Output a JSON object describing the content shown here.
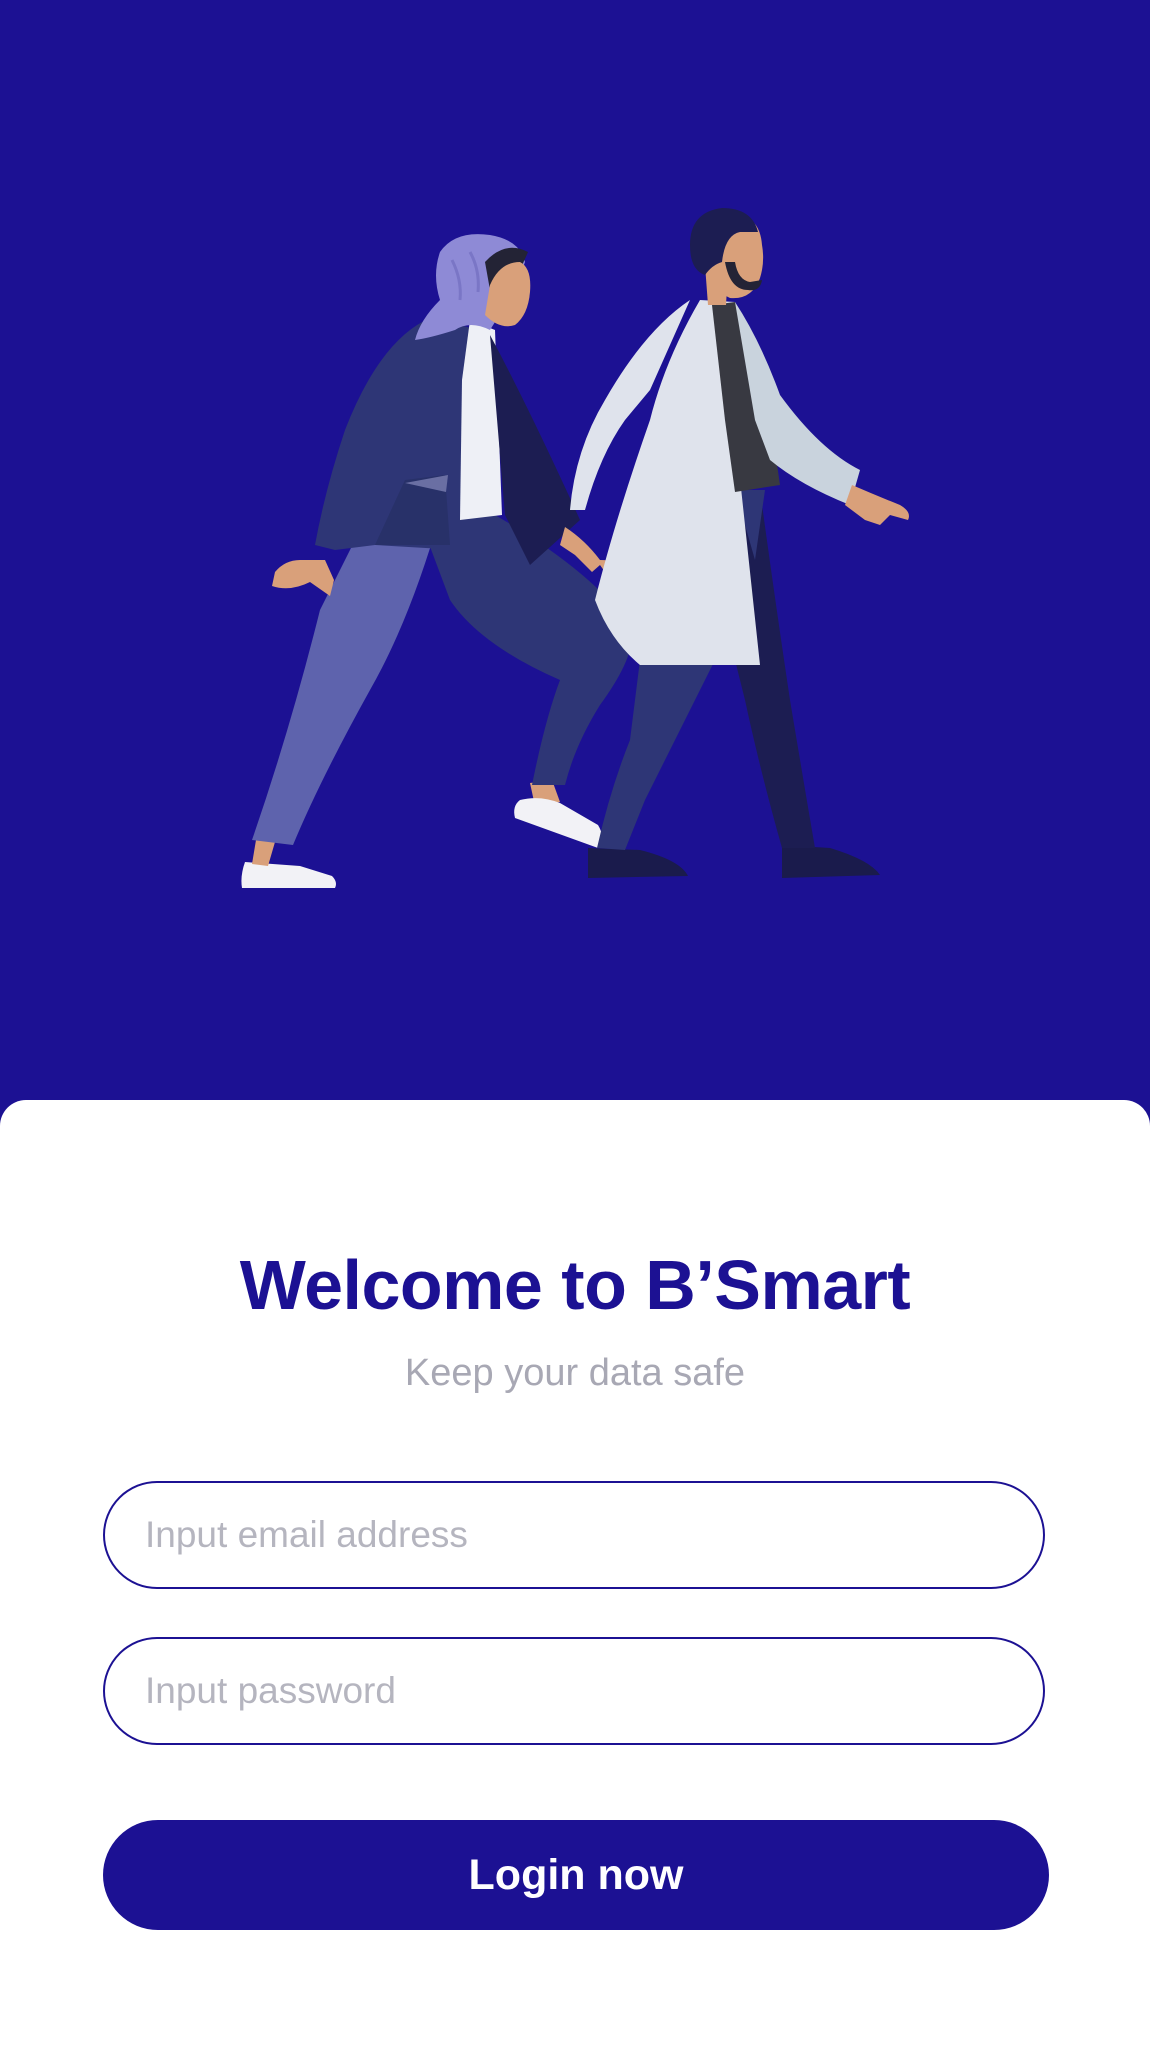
{
  "hero": {
    "illustration": "two-people-walking-illustration",
    "background_color": "#1c1193"
  },
  "welcome": {
    "title": "Welcome to B’Smart",
    "subtitle": "Keep your data safe"
  },
  "form": {
    "email_placeholder": "Input email address",
    "email_value": "",
    "password_placeholder": "Input password",
    "password_value": "",
    "login_label": "Login now"
  },
  "colors": {
    "primary": "#1c1193",
    "placeholder": "#b5b5bf",
    "subtitle": "#a8a8b4"
  }
}
